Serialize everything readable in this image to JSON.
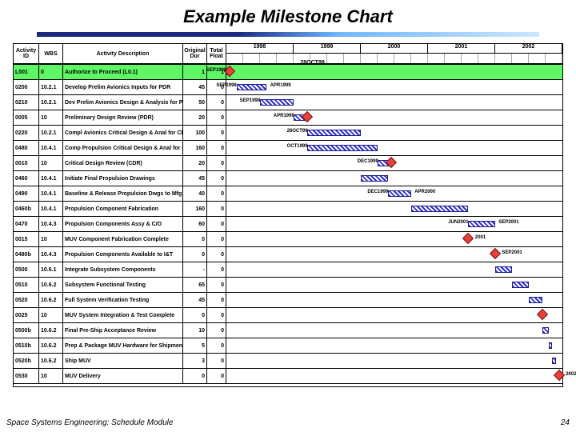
{
  "title": "Example Milestone Chart",
  "footer_left": "Space Systems Engineering: Schedule Module",
  "footer_right": "24",
  "columns": {
    "a": "Activity\nID",
    "b": "WBS",
    "c": "Activity\nDescription",
    "d": "Original\nDur",
    "e": "Total\nFloat"
  },
  "years": [
    "1998",
    "1999",
    "2000",
    "2001",
    "2002"
  ],
  "status_date": "28OCT99",
  "chart_data": {
    "type": "gantt",
    "x_axis": "calendar time",
    "x_range_years": [
      1998,
      2002
    ],
    "rows": [
      {
        "id": "L001",
        "wbs": "0",
        "desc": "Authorize to Proceed (L0.1)",
        "dur": "1",
        "float": "1",
        "highlight": true,
        "bar": [
          0,
          1
        ],
        "milestone": 1,
        "dates": [
          "SEP1998"
        ]
      },
      {
        "id": "0200",
        "wbs": "10.2.1",
        "desc": "Develop Prelim Avionics Inputs for PDR",
        "dur": "45",
        "float": "0",
        "bar": [
          3,
          12
        ],
        "dates": [
          "SEP1998",
          "APR1999"
        ]
      },
      {
        "id": "0210",
        "wbs": "10.2.1",
        "desc": "Dev Prelim Avionics Design & Analysis for PDR",
        "dur": "50",
        "float": "0",
        "bar": [
          10,
          20
        ],
        "dates": [
          "SEP1998"
        ]
      },
      {
        "id": "0005",
        "wbs": "10",
        "desc": "Preliminary Design Review (PDR)",
        "dur": "20",
        "float": "0",
        "bar": [
          20,
          24
        ],
        "milestone": 24,
        "dates": [
          "APR1999"
        ]
      },
      {
        "id": "0220",
        "wbs": "10.2.1",
        "desc": "Compl Avionics Critical Design & Anal for CDR",
        "dur": "100",
        "float": "0",
        "bar": [
          24,
          40
        ],
        "dates": [
          "28OCT99"
        ]
      },
      {
        "id": "0480",
        "wbs": "10.4.1",
        "desc": "Comp Propulsion Critical Design & Anal for CDR",
        "dur": "160",
        "float": "0",
        "bar": [
          24,
          45
        ],
        "dates": [
          "OCT1999"
        ]
      },
      {
        "id": "0010",
        "wbs": "10",
        "desc": "Critical Design Review (CDR)",
        "dur": "20",
        "float": "0",
        "bar": [
          45,
          49
        ],
        "milestone": 49,
        "dates": [
          "DEC1999"
        ]
      },
      {
        "id": "0460",
        "wbs": "10.4.1",
        "desc": "Initiate Final Propulsion Drawings",
        "dur": "45",
        "float": "0",
        "bar": [
          40,
          48
        ]
      },
      {
        "id": "0490",
        "wbs": "10.4.1",
        "desc": "Baseline & Release Propulsion Dwgs to Mfg",
        "dur": "40",
        "float": "0",
        "bar": [
          48,
          55
        ],
        "dates": [
          "DEC1999",
          "APR2000"
        ]
      },
      {
        "id": "0460b",
        "wbs": "10.4.1",
        "desc": "Propulsion Component Fabrication",
        "dur": "160",
        "float": "0",
        "bar": [
          55,
          72
        ]
      },
      {
        "id": "0470",
        "wbs": "10.4.3",
        "desc": "Propulsion Components Assy & C/O",
        "dur": "60",
        "float": "0",
        "bar": [
          72,
          80
        ],
        "dates": [
          "JUN2001",
          "SEP2001"
        ]
      },
      {
        "id": "0015",
        "wbs": "10",
        "desc": "MUV Component Fabrication Complete",
        "dur": "0",
        "float": "0",
        "milestone": 72,
        "dates": [
          "2001"
        ]
      },
      {
        "id": "0480b",
        "wbs": "10.4.3",
        "desc": "Propulsion Components Available to I&T",
        "dur": "0",
        "float": "0",
        "milestone": 80,
        "dates": [
          "SEP2001"
        ]
      },
      {
        "id": "0500",
        "wbs": "10.6.1",
        "desc": "Integrate Subsystem Components",
        "dur": "-",
        "float": "0",
        "bar": [
          80,
          85
        ]
      },
      {
        "id": "0510",
        "wbs": "10.6.2",
        "desc": "Subsystem Functional Testing",
        "dur": "65",
        "float": "0",
        "bar": [
          85,
          90
        ]
      },
      {
        "id": "0520",
        "wbs": "10.6.2",
        "desc": "Full System Verification Testing",
        "dur": "45",
        "float": "0",
        "bar": [
          90,
          94
        ]
      },
      {
        "id": "0025",
        "wbs": "10",
        "desc": "MUV System Integration & Test Complete",
        "dur": "0",
        "float": "0",
        "milestone": 94
      },
      {
        "id": "0500b",
        "wbs": "10.6.2",
        "desc": "Final Pre-Ship Acceptance Review",
        "dur": "10",
        "float": "0",
        "bar": [
          94,
          96
        ]
      },
      {
        "id": "0510b",
        "wbs": "10.6.2",
        "desc": "Prep & Package MUV Hardware for Shipment",
        "dur": "5",
        "float": "0",
        "bar": [
          96,
          97
        ]
      },
      {
        "id": "0520b",
        "wbs": "10.6.2",
        "desc": "Ship MUV",
        "dur": "3",
        "float": "0",
        "bar": [
          97,
          98
        ]
      },
      {
        "id": "0530",
        "wbs": "10",
        "desc": "MUV Delivery",
        "dur": "0",
        "float": "0",
        "milestone": 99,
        "dates": [
          "2002"
        ]
      }
    ]
  }
}
